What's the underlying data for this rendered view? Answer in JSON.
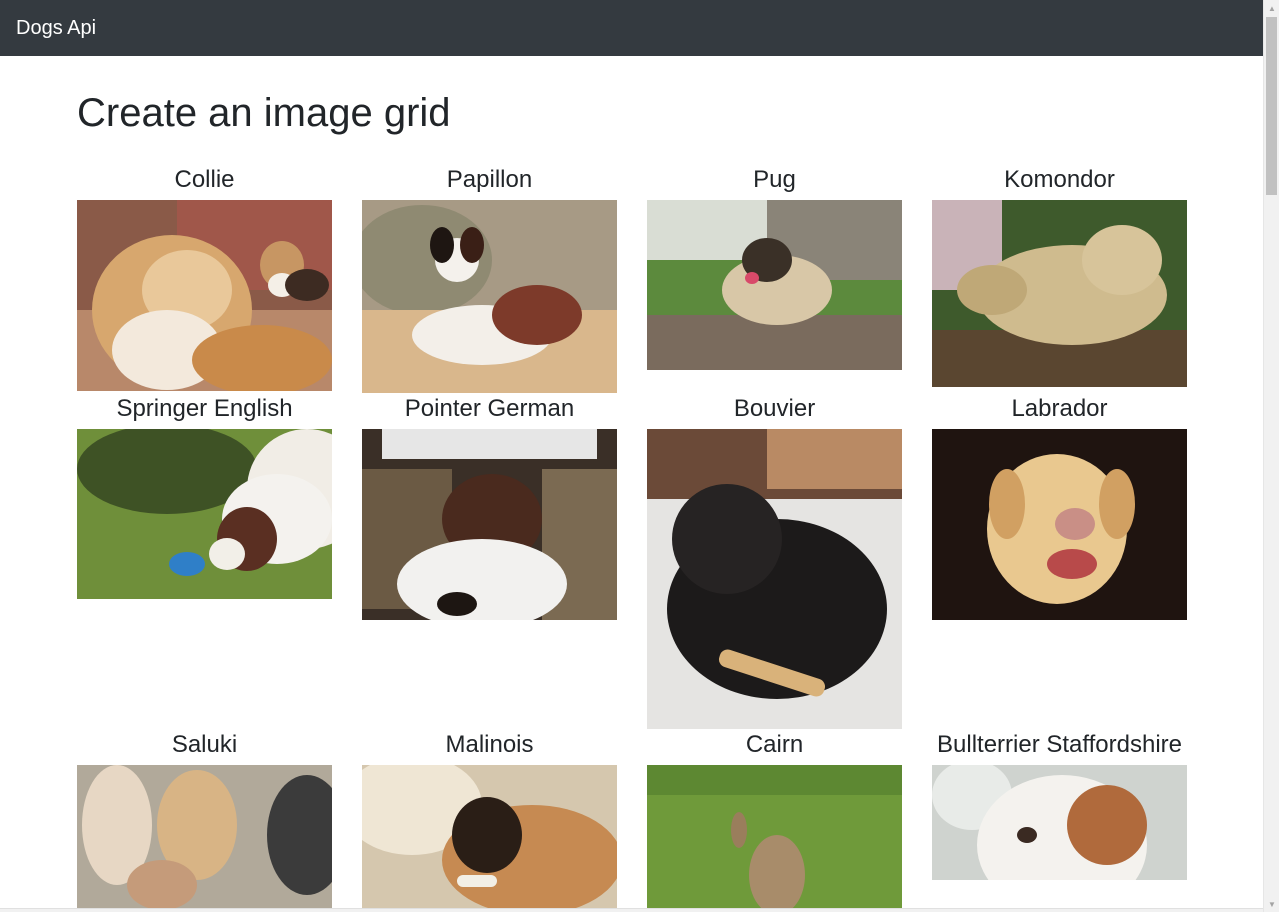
{
  "navbar": {
    "brand": "Dogs Api"
  },
  "page": {
    "title": "Create an image grid"
  },
  "dogs": [
    {
      "name": "Collie"
    },
    {
      "name": "Papillon"
    },
    {
      "name": "Pug"
    },
    {
      "name": "Komondor"
    },
    {
      "name": "Springer English"
    },
    {
      "name": "Pointer German"
    },
    {
      "name": "Bouvier"
    },
    {
      "name": "Labrador"
    },
    {
      "name": "Saluki"
    },
    {
      "name": "Malinois"
    },
    {
      "name": "Cairn"
    },
    {
      "name": "Bullterrier Staffordshire"
    }
  ]
}
